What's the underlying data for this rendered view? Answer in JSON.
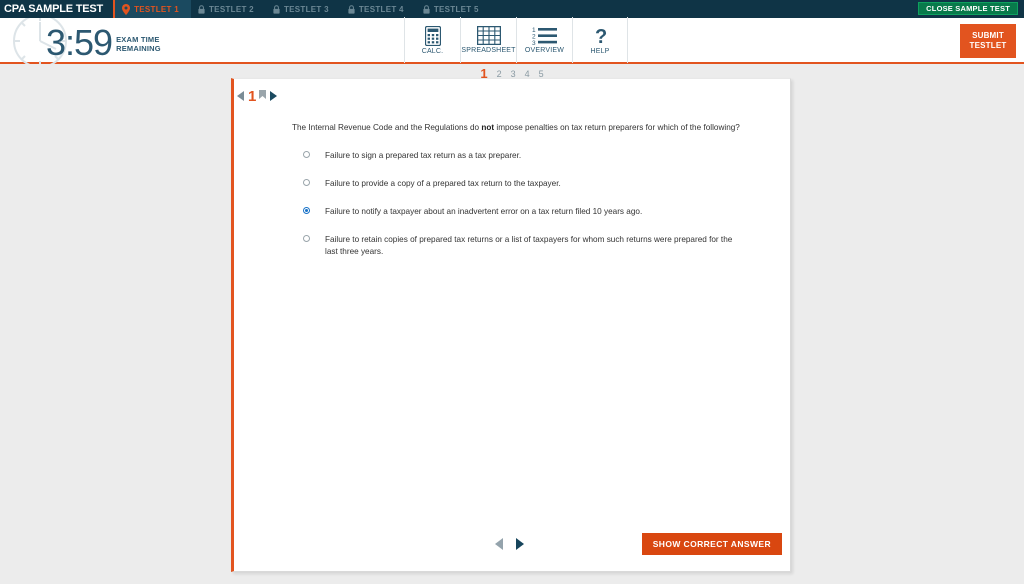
{
  "header": {
    "brand": "CPA SAMPLE TEST",
    "close_button": "CLOSE SAMPLE TEST",
    "tabs": [
      {
        "label": "TESTLET 1",
        "icon": "map-pin-icon",
        "locked": false,
        "active": true
      },
      {
        "label": "TESTLET 2",
        "icon": "lock-icon",
        "locked": true,
        "active": false
      },
      {
        "label": "TESTLET 3",
        "icon": "lock-icon",
        "locked": true,
        "active": false
      },
      {
        "label": "TESTLET 4",
        "icon": "lock-icon",
        "locked": true,
        "active": false
      },
      {
        "label": "TESTLET 5",
        "icon": "lock-icon",
        "locked": true,
        "active": false
      }
    ]
  },
  "toolbar": {
    "timer_value": "3:59",
    "timer_label_line1": "EXAM TIME",
    "timer_label_line2": "REMAINING",
    "tools": [
      {
        "label": "CALC.",
        "icon": "calculator-icon"
      },
      {
        "label": "SPREADSHEET",
        "icon": "spreadsheet-icon"
      },
      {
        "label": "OVERVIEW",
        "icon": "numbered-list-icon"
      },
      {
        "label": "HELP",
        "icon": "question-mark-icon"
      }
    ],
    "submit_line1": "SUBMIT",
    "submit_line2": "TESTLET"
  },
  "pagination": {
    "pages": [
      "1",
      "2",
      "3",
      "4",
      "5"
    ],
    "active_index": 0
  },
  "question": {
    "number": "1",
    "bookmark_icon": "bookmark-icon",
    "prev_icon": "triangle-left-icon",
    "next_icon": "triangle-right-icon",
    "prompt_before": "The Internal Revenue Code and the Regulations do ",
    "prompt_bold": "not",
    "prompt_after": " impose penalties on tax return preparers for which of the following?",
    "options": [
      {
        "text": "Failure to sign a prepared tax return as a tax preparer.",
        "selected": false
      },
      {
        "text": "Failure to provide a copy of a prepared tax return to the taxpayer.",
        "selected": false
      },
      {
        "text": "Failure to notify a taxpayer about an inadvertent error on a tax return filed 10 years ago.",
        "selected": true
      },
      {
        "text": "Failure to retain copies of prepared tax returns or a list of taxpayers for whom such returns were prepared for the last three years.",
        "selected": false
      }
    ]
  },
  "footer": {
    "prev_icon": "triangle-left-icon",
    "next_icon": "triangle-right-icon",
    "show_answer_button": "SHOW CORRECT ANSWER"
  },
  "colors": {
    "navy": "#0f3446",
    "navy_active_tab": "#1b4a60",
    "orange": "#e2541f",
    "orange_dark": "#d94710",
    "green": "#087a4b",
    "steel_blue": "#2c5871",
    "radio_blue": "#1a73c8"
  }
}
